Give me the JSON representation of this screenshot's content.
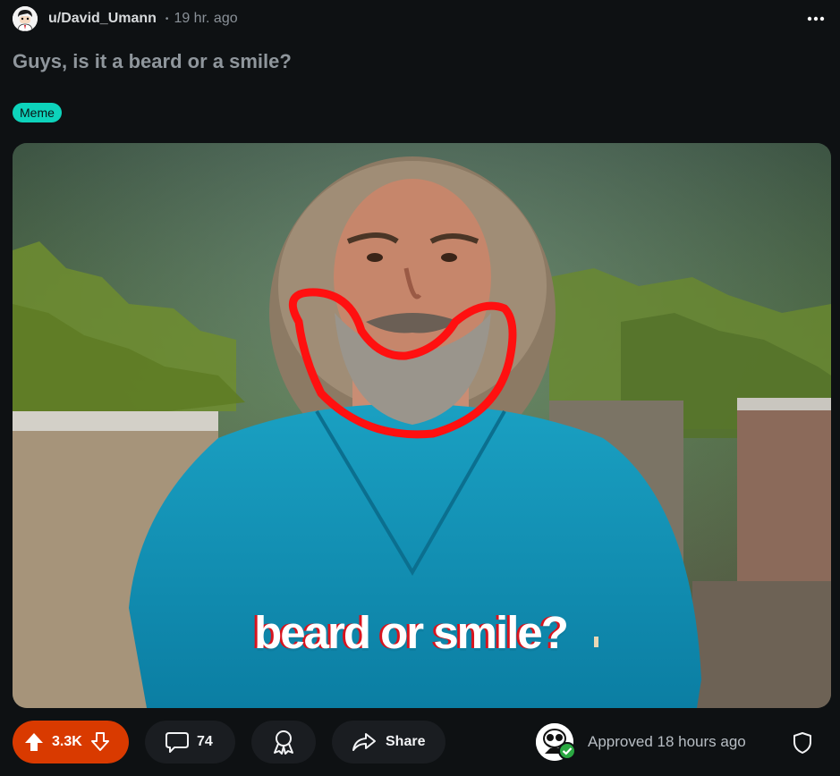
{
  "post": {
    "author": "u/David_Umann",
    "separator": "•",
    "time": "19 hr. ago",
    "title": "Guys, is it a beard or a smile?",
    "flair": "Meme",
    "image_caption": "beard or smile?"
  },
  "actions": {
    "votes": "3.3K",
    "comments": "74",
    "share_label": "Share",
    "approved_text": "Approved 18 hours ago"
  },
  "colors": {
    "background": "#0e1113",
    "flair": "#0dd3bb",
    "upvote_active": "#d93a00",
    "pill": "#1a1d21",
    "approved_check": "#2aa841"
  },
  "icons": [
    "user-avatar-icon",
    "more-options-icon",
    "upvote-icon",
    "downvote-icon",
    "comment-icon",
    "award-icon",
    "share-icon",
    "moderator-avatar-icon",
    "approved-check-icon",
    "mod-shield-icon"
  ]
}
